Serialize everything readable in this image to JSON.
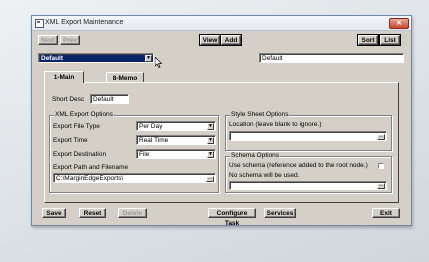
{
  "window": {
    "title": "XML Export Maintenance",
    "close_glyph": "✕"
  },
  "toolbar": {
    "next": "Next",
    "prev": "Prev",
    "view": "View",
    "add": "Add",
    "sort": "Sort",
    "list": "List"
  },
  "record_select": {
    "value": "Default"
  },
  "record_name": {
    "value": "Default"
  },
  "tabs": [
    {
      "label": "1-Main"
    },
    {
      "label": "8-Memo"
    }
  ],
  "main": {
    "short_desc": {
      "label": "Short Desc",
      "value": "Default"
    },
    "xml_export_options": {
      "title": "XML Export Options",
      "file_type": {
        "label": "Export File Type",
        "value": "Per Day"
      },
      "time": {
        "label": "Export Time",
        "value": "Real Time"
      },
      "destination": {
        "label": "Export Destination",
        "value": "File"
      },
      "path": {
        "label": "Export Path and Filename",
        "value": "C:\\MarginEdgeExports\\"
      }
    },
    "style_sheet": {
      "title": "Style Sheet Options",
      "location_label": "Location (leave blank to ignore.)",
      "location_value": ""
    },
    "schema": {
      "title": "Schema Options",
      "use_schema_label": "Use schema (reference added to the root node.)",
      "use_schema_checked": false,
      "note": "No schema will be used.",
      "value": ""
    }
  },
  "bottom_buttons": {
    "save": "Save",
    "reset": "Reset",
    "delete": "Delete",
    "configure_task": "Configure Task",
    "services": "Services",
    "exit": "Exit"
  },
  "icons": {
    "combo_arrow": "▼",
    "browse": "..."
  }
}
